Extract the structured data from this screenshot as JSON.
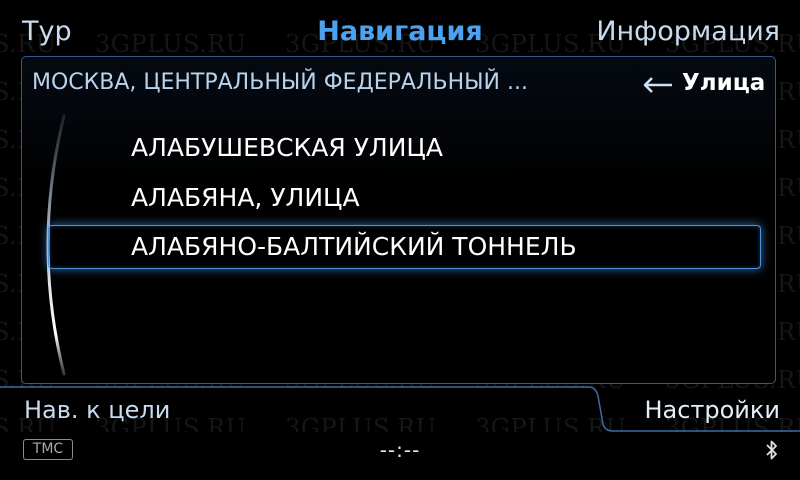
{
  "watermark": "3GPLUS.RU",
  "top_tabs": {
    "left": "Тур",
    "center": "Навигация",
    "right": "Информация"
  },
  "breadcrumb": {
    "path": "МОСКВА, ЦЕНТРАЛЬНЫЙ ФЕДЕРАЛЬНЫЙ ...",
    "back_icon": "return-arrow-icon",
    "current_level": "Улица"
  },
  "list": {
    "items": [
      {
        "label": "АЛАБУШЕВСКАЯ УЛИЦА",
        "selected": false
      },
      {
        "label": "АЛАБЯНА, УЛИЦА",
        "selected": false
      },
      {
        "label": "АЛАБЯНО-БАЛТИЙСКИЙ ТОННЕЛЬ",
        "selected": true
      }
    ]
  },
  "bottom_tabs": {
    "left": "Нав. к цели",
    "right": "Настройки"
  },
  "status_bar": {
    "tmc": "TMC",
    "clock": "--:--",
    "bluetooth_icon": "bluetooth-icon"
  },
  "colors": {
    "background": "#000000",
    "accent": "#4da2f0",
    "frame": "#345b86",
    "text_primary": "#ffffff",
    "text_secondary": "#b9d3ec"
  }
}
